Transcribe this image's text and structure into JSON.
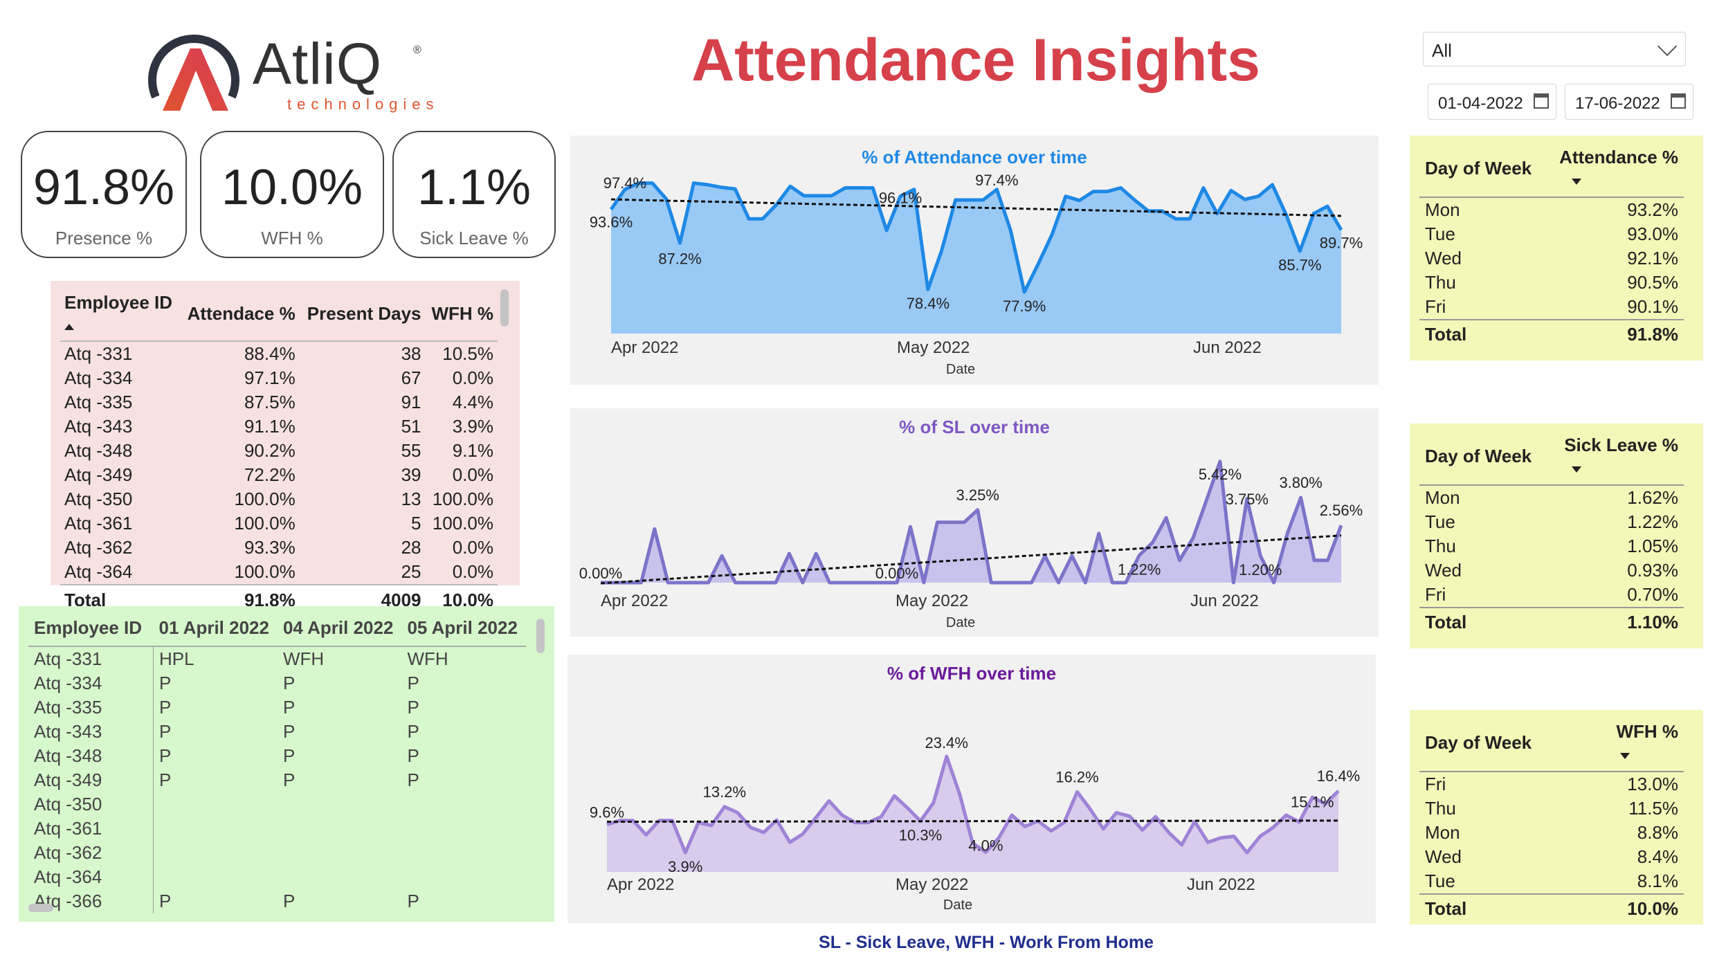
{
  "logo": {
    "brand": "AtliQ",
    "reg": "®",
    "tagline": "technologies"
  },
  "title": "Attendance Insights",
  "filters": {
    "dropdown_value": "All",
    "start_date": "01-04-2022",
    "end_date": "17-06-2022"
  },
  "kpis": [
    {
      "value": "91.8%",
      "label": "Presence %"
    },
    {
      "value": "10.0%",
      "label": "WFH %"
    },
    {
      "value": "1.1%",
      "label": "Sick Leave %"
    }
  ],
  "employee_table": {
    "headers": [
      "Employee ID",
      "Attendace %",
      "Present Days",
      "WFH %"
    ],
    "rows": [
      [
        "Atq -331",
        "88.4%",
        "38",
        "10.5%"
      ],
      [
        "Atq -334",
        "97.1%",
        "67",
        "0.0%"
      ],
      [
        "Atq -335",
        "87.5%",
        "91",
        "4.4%"
      ],
      [
        "Atq -343",
        "91.1%",
        "51",
        "3.9%"
      ],
      [
        "Atq -348",
        "90.2%",
        "55",
        "9.1%"
      ],
      [
        "Atq -349",
        "72.2%",
        "39",
        "0.0%"
      ],
      [
        "Atq -350",
        "100.0%",
        "13",
        "100.0%"
      ],
      [
        "Atq -361",
        "100.0%",
        "5",
        "100.0%"
      ],
      [
        "Atq -362",
        "93.3%",
        "28",
        "0.0%"
      ],
      [
        "Atq -364",
        "100.0%",
        "25",
        "0.0%"
      ]
    ],
    "total": [
      "Total",
      "91.8%",
      "4009",
      "10.0%"
    ]
  },
  "daily_matrix": {
    "headers": [
      "Employee ID",
      "01 April 2022",
      "04 April 2022",
      "05 April 2022"
    ],
    "rows": [
      [
        "Atq -331",
        "HPL",
        "WFH",
        "WFH"
      ],
      [
        "Atq -334",
        "P",
        "P",
        "P"
      ],
      [
        "Atq -335",
        "P",
        "P",
        "P"
      ],
      [
        "Atq -343",
        "P",
        "P",
        "P"
      ],
      [
        "Atq -348",
        "P",
        "P",
        "P"
      ],
      [
        "Atq -349",
        "P",
        "P",
        "P"
      ],
      [
        "Atq -350",
        "",
        "",
        ""
      ],
      [
        "Atq -361",
        "",
        "",
        ""
      ],
      [
        "Atq -362",
        "",
        "",
        ""
      ],
      [
        "Atq -364",
        "",
        "",
        ""
      ],
      [
        "Atq -366",
        "P",
        "P",
        "P"
      ]
    ]
  },
  "chart_data": [
    {
      "id": "attendance",
      "type": "area",
      "title": "% of Attendance over time",
      "xlabel": "Date",
      "ylabel": "",
      "x_ticks": [
        "Apr 2022",
        "May 2022",
        "Jun 2022"
      ],
      "ylim": [
        70,
        100
      ],
      "trendline": true,
      "color": "#1e88e5",
      "fill": "#99c9f5",
      "title_color": "#1e88e5",
      "x": [
        0,
        1,
        2,
        3,
        4,
        5,
        6,
        7,
        8,
        9,
        10,
        11,
        12,
        13,
        14,
        15,
        16,
        17,
        18,
        19,
        20,
        21,
        22,
        23,
        24,
        25,
        26,
        27,
        28,
        29,
        30,
        31,
        32,
        33,
        34,
        35,
        36,
        37,
        38,
        39,
        40,
        41,
        42,
        43,
        44,
        45,
        46,
        47,
        48,
        49,
        50,
        51,
        52,
        53
      ],
      "values": [
        93.6,
        97.4,
        98.6,
        98.6,
        95.6,
        87.2,
        98.6,
        98.3,
        97.8,
        97.5,
        91.8,
        91.8,
        94.5,
        98.0,
        96.2,
        96.2,
        96.2,
        97.7,
        97.7,
        97.7,
        89.6,
        96.1,
        97.4,
        78.4,
        85.8,
        95.4,
        95.4,
        95.4,
        97.4,
        89.6,
        77.9,
        83.2,
        88.8,
        96.1,
        95.3,
        97.0,
        97.0,
        97.7,
        95.4,
        93.3,
        93.3,
        91.8,
        91.8,
        97.7,
        92.8,
        97.2,
        95.5,
        96.1,
        98.3,
        92.6,
        85.7,
        92.8,
        94.2,
        89.7
      ],
      "labels": [
        {
          "i": 0,
          "text": "93.6%",
          "dy": 26
        },
        {
          "i": 1,
          "text": "97.4%",
          "dy": -2
        },
        {
          "i": 5,
          "text": "87.2%",
          "dy": 30
        },
        {
          "i": 21,
          "text": "96.1%",
          "dy": 10
        },
        {
          "i": 23,
          "text": "78.4%",
          "dy": 28
        },
        {
          "i": 28,
          "text": "97.4%",
          "dy": -6
        },
        {
          "i": 30,
          "text": "77.9%",
          "dy": 28
        },
        {
          "i": 50,
          "text": "85.7%",
          "dy": 28
        },
        {
          "i": 53,
          "text": "89.7%",
          "dy": 26
        }
      ]
    },
    {
      "id": "sl",
      "type": "area",
      "title": "% of SL over time",
      "xlabel": "Date",
      "ylabel": "",
      "x_ticks": [
        "Apr 2022",
        "May 2022",
        "Jun 2022"
      ],
      "ylim": [
        0,
        6
      ],
      "trendline": true,
      "color": "#7b74c9",
      "fill": "#c7c3ec",
      "title_color": "#7e57c2",
      "x": [
        0,
        1,
        2,
        3,
        4,
        5,
        6,
        7,
        8,
        9,
        10,
        11,
        12,
        13,
        14,
        15,
        16,
        17,
        18,
        19,
        20,
        21,
        22,
        23,
        24,
        25,
        26,
        27,
        28,
        29,
        30,
        31,
        32,
        33,
        34,
        35,
        36,
        37,
        38,
        39,
        40,
        41,
        42,
        43,
        44,
        45,
        46,
        47,
        48,
        49,
        50,
        51,
        52,
        53
      ],
      "values": [
        0.0,
        0.0,
        0.0,
        0.0,
        2.4,
        0.0,
        0.0,
        0.0,
        0.0,
        1.2,
        0.0,
        0.0,
        0.0,
        0.0,
        1.3,
        0.0,
        1.3,
        0.0,
        0.0,
        0.0,
        0.0,
        0.0,
        0.0,
        2.5,
        0.0,
        2.7,
        2.7,
        2.7,
        3.25,
        0.0,
        0.0,
        0.0,
        0.0,
        1.2,
        0.0,
        1.2,
        0.0,
        2.2,
        0.0,
        0.0,
        1.22,
        1.8,
        2.9,
        1.0,
        2.0,
        3.7,
        5.42,
        0.0,
        3.75,
        1.2,
        0.0,
        2.2,
        3.8,
        1.0,
        1.0,
        2.56
      ],
      "labels": [
        {
          "i": 0,
          "text": "0.00%",
          "dy": -6
        },
        {
          "i": 22,
          "text": "0.00%",
          "dy": -6
        },
        {
          "i": 28,
          "text": "3.25%",
          "dy": -14
        },
        {
          "i": 40,
          "text": "1.22%",
          "dy": 28
        },
        {
          "i": 46,
          "text": "5.42%",
          "dy": 26
        },
        {
          "i": 48,
          "text": "3.75%",
          "dy": 8
        },
        {
          "i": 49,
          "text": "1.20%",
          "dy": 28
        },
        {
          "i": 52,
          "text": "3.80%",
          "dy": -14
        },
        {
          "i": 55,
          "text": "2.56%",
          "dy": -14
        }
      ]
    },
    {
      "id": "wfh",
      "type": "area",
      "title": "% of WFH over time",
      "xlabel": "Date",
      "ylabel": "",
      "x_ticks": [
        "Apr 2022",
        "May 2022",
        "Jun 2022"
      ],
      "ylim": [
        0,
        30
      ],
      "trendline": true,
      "color": "#9f83d6",
      "fill": "#d8cbec",
      "title_color": "#6a1b9a",
      "x": [
        0,
        1,
        2,
        3,
        4,
        5,
        6,
        7,
        8,
        9,
        10,
        11,
        12,
        13,
        14,
        15,
        16,
        17,
        18,
        19,
        20,
        21,
        22,
        23,
        24,
        25,
        26,
        27,
        28,
        29,
        30,
        31,
        32,
        33,
        34,
        35,
        36,
        37,
        38,
        39,
        40,
        41,
        42,
        43,
        44,
        45,
        46,
        47,
        48,
        49,
        50,
        51,
        52,
        53
      ],
      "values": [
        9.6,
        10.4,
        10.4,
        7.5,
        10.4,
        10.4,
        3.9,
        10.0,
        9.4,
        13.2,
        12.0,
        9.0,
        8.0,
        10.5,
        6.0,
        7.7,
        11.0,
        14.4,
        11.5,
        10.0,
        10.0,
        11.2,
        15.4,
        13.0,
        10.3,
        14.0,
        23.4,
        15.8,
        5.8,
        4.0,
        6.9,
        11.5,
        9.2,
        10.3,
        8.3,
        10.0,
        16.2,
        12.7,
        8.7,
        12.0,
        11.3,
        8.5,
        11.2,
        8.0,
        5.5,
        10.2,
        6.0,
        6.9,
        7.2,
        3.9,
        7.2,
        9.0,
        11.5,
        10.1,
        15.1,
        13.8,
        16.4
      ],
      "labels": [
        {
          "i": 0,
          "text": "9.6%",
          "dy": -10
        },
        {
          "i": 6,
          "text": "3.9%",
          "dy": 28
        },
        {
          "i": 9,
          "text": "13.2%",
          "dy": -14
        },
        {
          "i": 24,
          "text": "10.3%",
          "dy": 28
        },
        {
          "i": 26,
          "text": "23.4%",
          "dy": -12
        },
        {
          "i": 29,
          "text": "4.0%",
          "dy": -2
        },
        {
          "i": 36,
          "text": "16.2%",
          "dy": -14
        },
        {
          "i": 54,
          "text": "15.1%",
          "dy": 14
        },
        {
          "i": 56,
          "text": "16.4%",
          "dy": -14
        }
      ]
    }
  ],
  "dow_attendance": {
    "headers": [
      "Day of Week",
      "Attendance %"
    ],
    "rows": [
      [
        "Mon",
        "93.2%"
      ],
      [
        "Tue",
        "93.0%"
      ],
      [
        "Wed",
        "92.1%"
      ],
      [
        "Thu",
        "90.5%"
      ],
      [
        "Fri",
        "90.1%"
      ]
    ],
    "total": [
      "Total",
      "91.8%"
    ]
  },
  "dow_sick": {
    "headers": [
      "Day of Week",
      "Sick Leave %"
    ],
    "rows": [
      [
        "Mon",
        "1.62%"
      ],
      [
        "Tue",
        "1.22%"
      ],
      [
        "Thu",
        "1.05%"
      ],
      [
        "Wed",
        "0.93%"
      ],
      [
        "Fri",
        "0.70%"
      ]
    ],
    "total": [
      "Total",
      "1.10%"
    ]
  },
  "dow_wfh": {
    "headers": [
      "Day of Week",
      "WFH %"
    ],
    "rows": [
      [
        "Fri",
        "13.0%"
      ],
      [
        "Thu",
        "11.5%"
      ],
      [
        "Mon",
        "8.8%"
      ],
      [
        "Wed",
        "8.4%"
      ],
      [
        "Tue",
        "8.1%"
      ]
    ],
    "total": [
      "Total",
      "10.0%"
    ]
  },
  "footer_note": "SL - Sick Leave, WFH - Work From Home"
}
